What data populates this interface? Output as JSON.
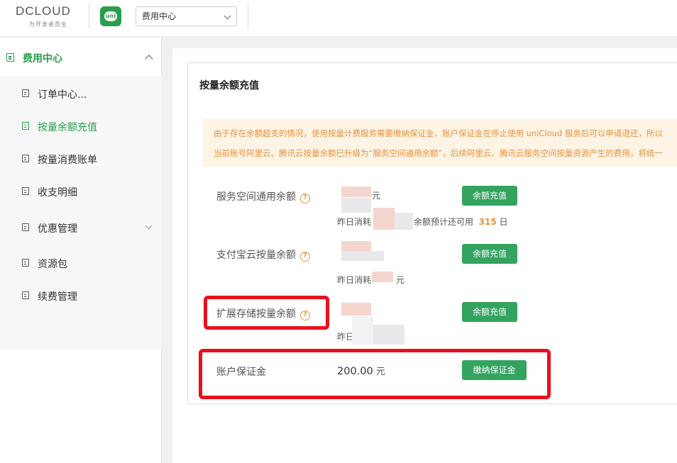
{
  "header": {
    "logo_text": "DCLOUD",
    "logo_tagline": "为开发者而生",
    "app_badge": "uni",
    "module_select": "费用中心"
  },
  "sidebar": {
    "group_label": "费用中心",
    "items": [
      {
        "label": "订单中心..."
      },
      {
        "label": "按量余额充值"
      },
      {
        "label": "按量消费账单"
      },
      {
        "label": "收支明细"
      },
      {
        "label": "优惠管理"
      },
      {
        "label": "资源包"
      },
      {
        "label": "续费管理"
      }
    ]
  },
  "page": {
    "title": "按量余额充值",
    "notice_lines": [
      "由于存在余额超支的情况，使用按量计费服务需要缴纳保证金，账户保证金在停止使用 uniCloud 服务后可以申请退还，所以",
      "当前账号阿里云、腾讯云按量余额已升级为“服务空间通用余额”，后续阿里云、腾讯云服务空间按量资源产生的费用，将统一"
    ],
    "help_icon": "?",
    "rows": {
      "general": {
        "label": "服务空间通用余额",
        "unit": "元",
        "yesterday_prefix": "昨日消耗",
        "forecast_prefix": "余额预计还可用",
        "forecast_days": "315",
        "forecast_unit": "日",
        "button": "余额充值"
      },
      "alipay": {
        "label": "支付宝云按量余额",
        "yesterday_prefix": "昨日消耗",
        "unit": "元",
        "button": "余额充值"
      },
      "storage": {
        "label": "扩展存储按量余额",
        "yesterday_prefix": "昨日",
        "button": "余额充值"
      },
      "deposit": {
        "label": "账户保证金",
        "amount": "200.00",
        "unit": "元",
        "button": "缴纳保证金"
      }
    }
  },
  "colors": {
    "brand_green": "#2a9d4f",
    "button_green": "#33a35f",
    "notice_orange": "#e8913a",
    "highlight_red": "#e8101e"
  }
}
